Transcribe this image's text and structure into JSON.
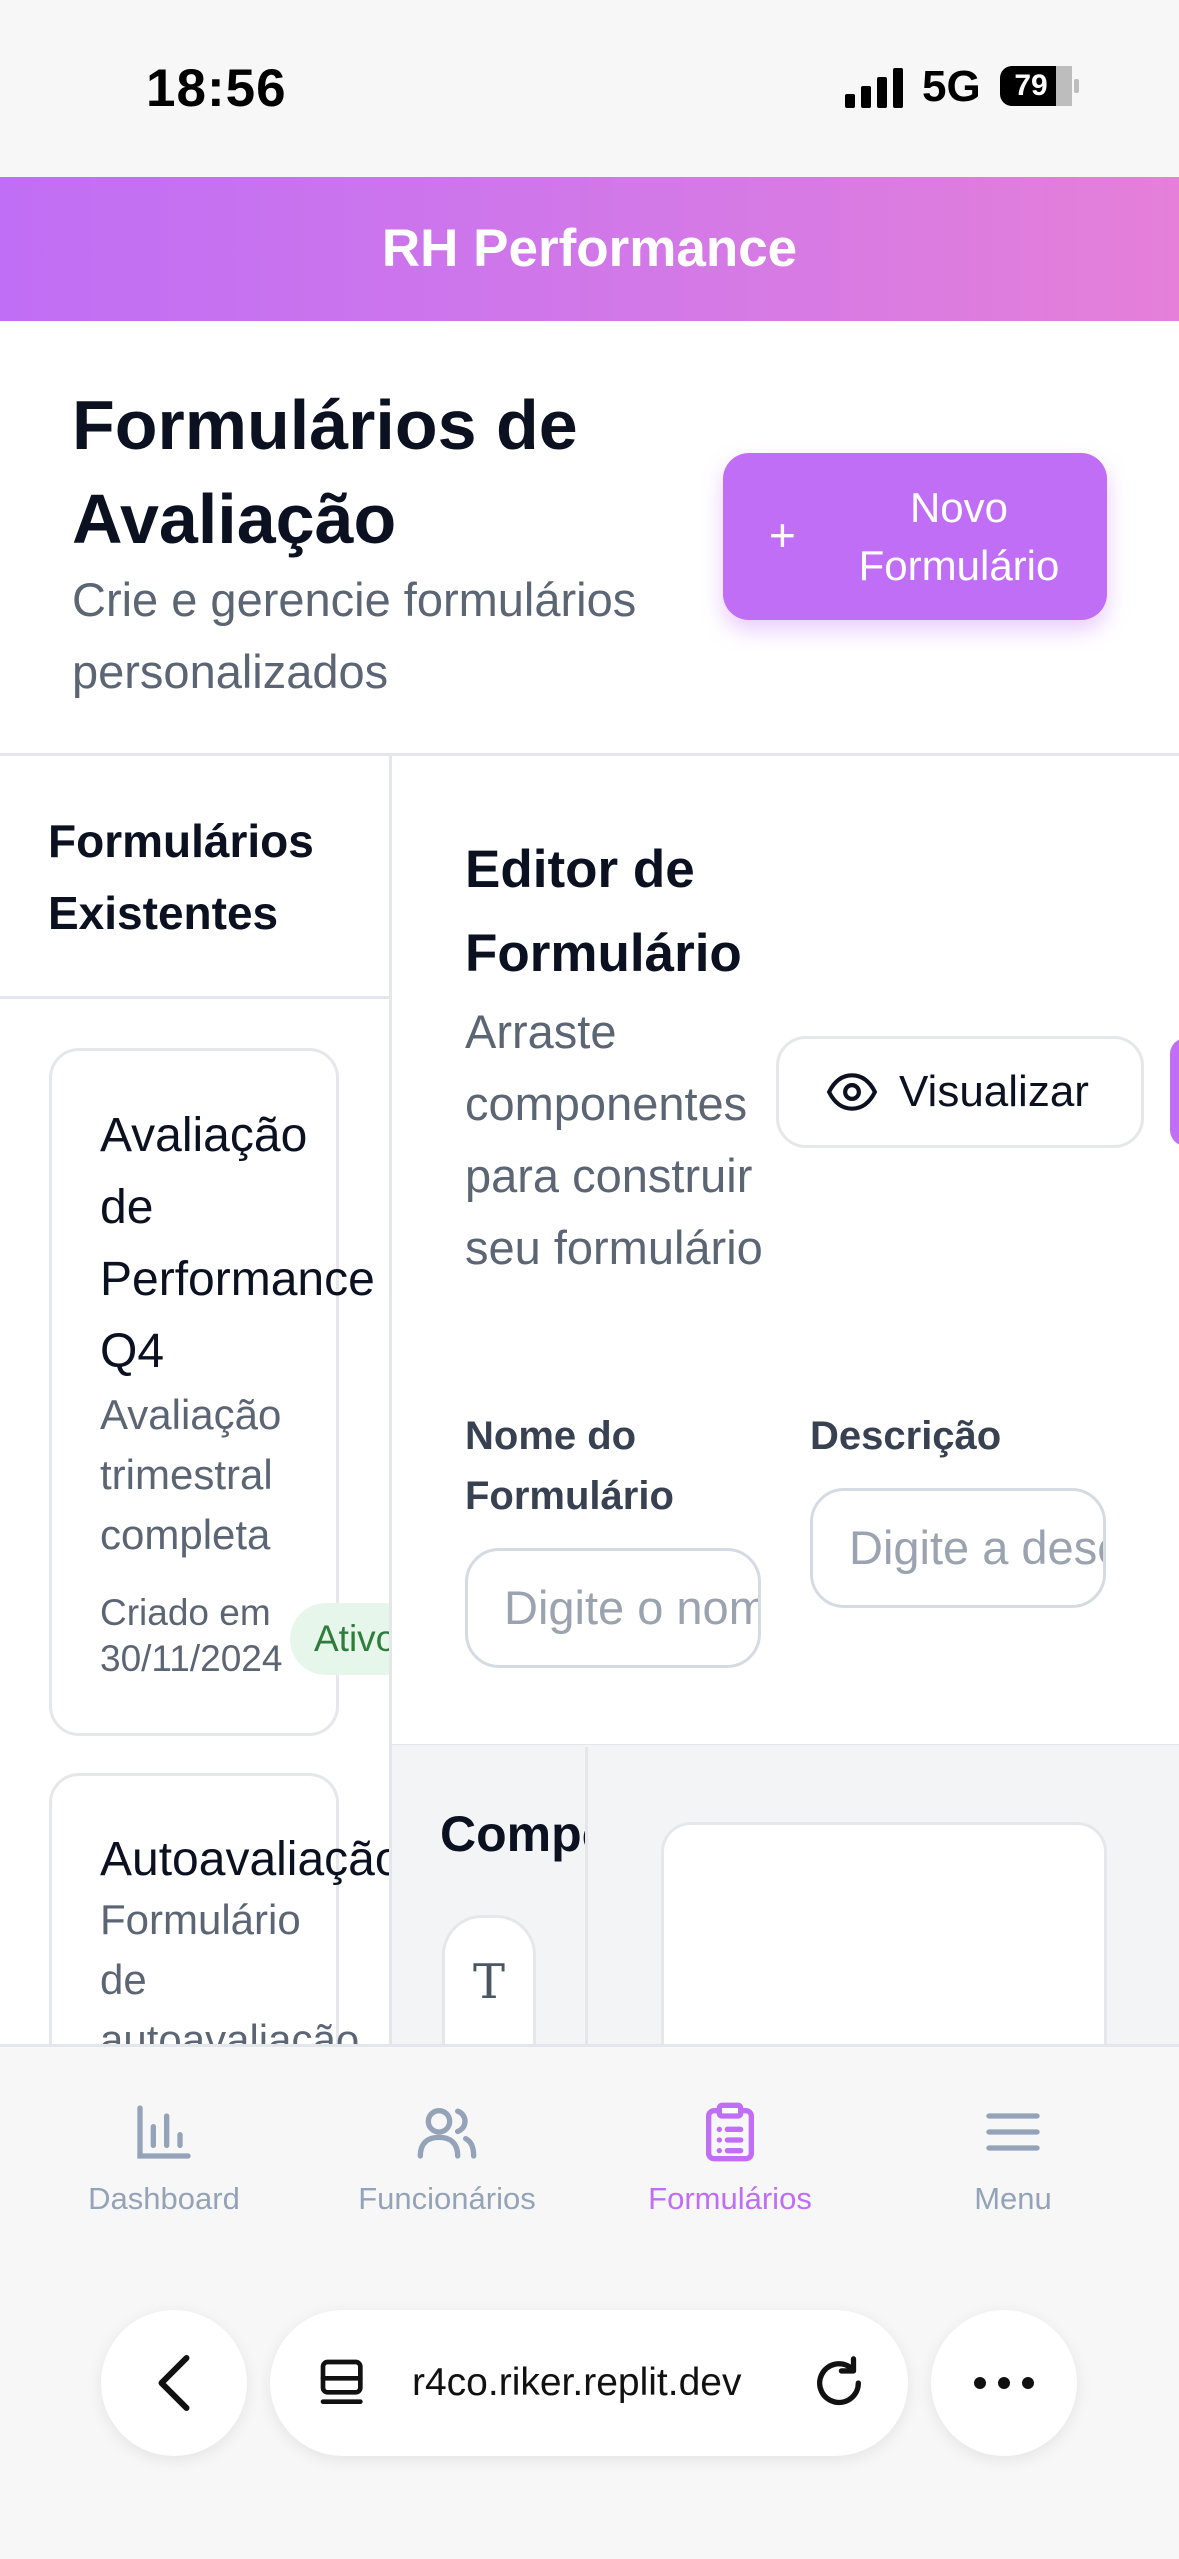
{
  "status": {
    "time": "18:56",
    "network": "5G",
    "battery": "79"
  },
  "app": {
    "title": "RH Performance"
  },
  "page": {
    "title": "Formulários de Avaliação",
    "subtitle": "Crie e gerencie formulários personalizados",
    "new_button_icon": "+",
    "new_button_label": "Novo Formulário"
  },
  "forms_list": {
    "title": "Formulários Existentes",
    "items": [
      {
        "title": "Avaliação de Performance Q4",
        "description": "Avaliação trimestral completa",
        "created": "Criado em 30/11/2024",
        "status": "Ativo"
      },
      {
        "title": "Autoavaliação",
        "description": "Formulário de autoavaliação"
      }
    ]
  },
  "editor": {
    "title": "Editor de Formulário",
    "subtitle": "Arraste componentes para construir seu formulário",
    "preview_button": "Visualizar",
    "name_label": "Nome do Formulário",
    "name_placeholder": "Digite o nome",
    "desc_label": "Descrição",
    "desc_placeholder": "Digite a descrição",
    "components_label": "Componentes",
    "text_component_icon": "T"
  },
  "nav": {
    "items": [
      {
        "label": "Dashboard",
        "icon": "bar-chart-icon",
        "active": false
      },
      {
        "label": "Funcionários",
        "icon": "users-icon",
        "active": false
      },
      {
        "label": "Formulários",
        "icon": "clipboard-list-icon",
        "active": true
      },
      {
        "label": "Menu",
        "icon": "menu-icon",
        "active": false
      }
    ],
    "active_color": "#c06ef5",
    "inactive_color": "#94a3b8"
  },
  "browser": {
    "url": "r4co.riker.replit.dev"
  },
  "colors": {
    "brand": "#c06ef5",
    "header_gradient_end": "#e57fd9",
    "badge_bg": "#e6f6ea",
    "badge_text": "#2e7d3d"
  }
}
